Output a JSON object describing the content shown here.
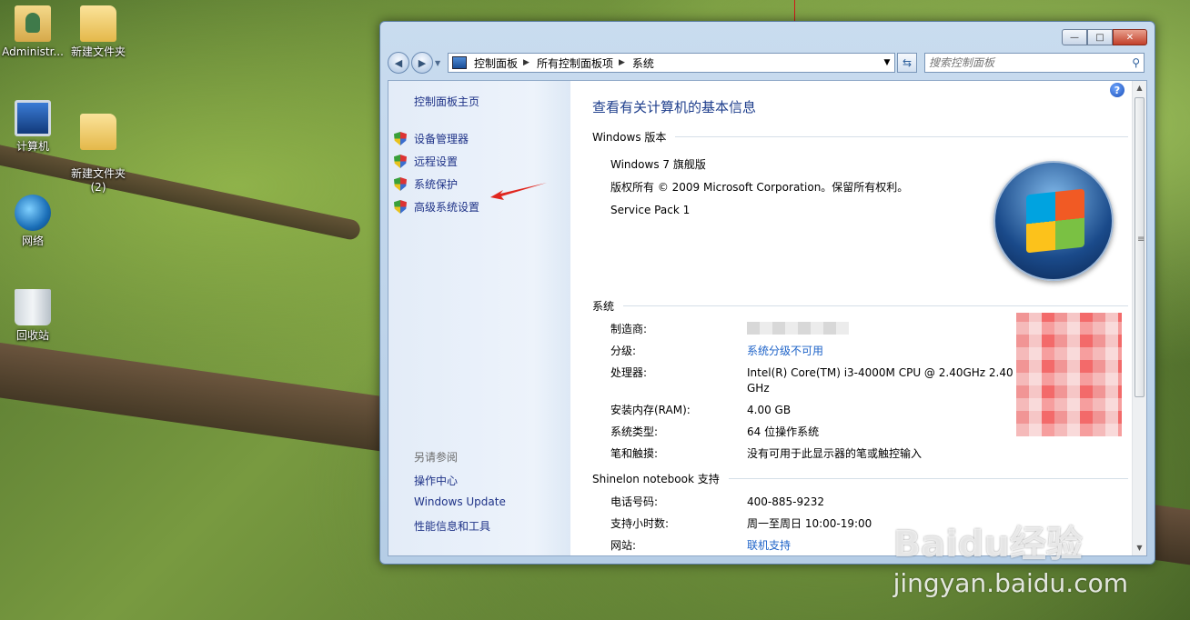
{
  "desktop": {
    "icons": [
      {
        "label": "Administr..."
      },
      {
        "label": "新建文件夹"
      },
      {
        "label": "计算机"
      },
      {
        "label": "新建文件夹\n(2)"
      },
      {
        "label": "网络"
      },
      {
        "label": "回收站"
      }
    ]
  },
  "window": {
    "controls": {
      "minimize": "—",
      "maximize": "□",
      "close": "✕"
    },
    "nav": {
      "back": "◀",
      "forward": "▶"
    },
    "breadcrumb": [
      "控制面板",
      "所有控制面板项",
      "系统"
    ],
    "search": {
      "placeholder": "搜索控制面板"
    }
  },
  "left_pane": {
    "home": "控制面板主页",
    "tasks": [
      "设备管理器",
      "远程设置",
      "系统保护",
      "高级系统设置"
    ],
    "see_also": {
      "heading": "另请参阅",
      "links": [
        "操作中心",
        "Windows Update",
        "性能信息和工具"
      ]
    }
  },
  "main": {
    "title": "查看有关计算机的基本信息",
    "edition_section": {
      "heading": "Windows 版本",
      "lines": [
        "Windows 7 旗舰版",
        "版权所有 © 2009 Microsoft Corporation。保留所有权利。",
        "Service Pack 1"
      ]
    },
    "system_section": {
      "heading": "系统",
      "rows": [
        {
          "label": "制造商:",
          "value": ""
        },
        {
          "label": "分级:",
          "value": "系统分级不可用"
        },
        {
          "label": "处理器:",
          "value": "Intel(R) Core(TM) i3-4000M CPU @ 2.40GHz   2.40 GHz"
        },
        {
          "label": "安装内存(RAM):",
          "value": "4.00 GB"
        },
        {
          "label": "系统类型:",
          "value": "64 位操作系统"
        },
        {
          "label": "笔和触摸:",
          "value": "没有可用于此显示器的笔或触控输入"
        }
      ]
    },
    "support_section": {
      "heading": "Shinelon notebook 支持",
      "rows": [
        {
          "label": "电话号码:",
          "value": "400-885-9232"
        },
        {
          "label": "支持小时数:",
          "value": "周一至周日 10:00-19:00"
        },
        {
          "label": "网站:",
          "value": "联机支持"
        }
      ]
    }
  },
  "watermark": {
    "main": "Baidu经验",
    "url": "jingyan.baidu.com"
  },
  "colors": {
    "link": "#1e3287",
    "title": "#1e3e8c",
    "value_link": "#1e63c8",
    "arrow": "#e0261e"
  }
}
